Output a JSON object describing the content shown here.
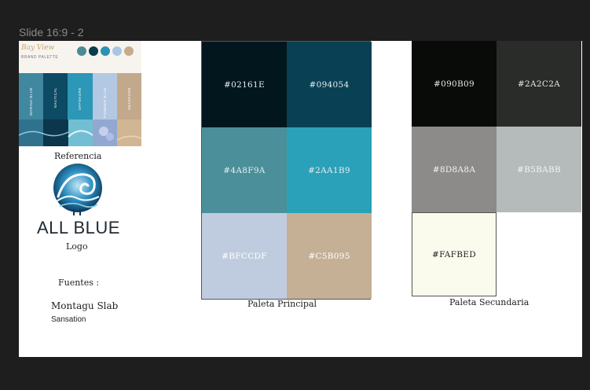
{
  "frame": {
    "label": "Slide 16:9 - 2"
  },
  "reference": {
    "caption": "Referencia",
    "title": "Bay View",
    "subtitle": "BRAND PALETTE",
    "dots": [
      "#4d8a94",
      "#0c3b4c",
      "#2a93b2",
      "#a9c6e4",
      "#c7ab8c"
    ],
    "strips": [
      {
        "label": "MARINA BLUE",
        "color": "#3f88a0"
      },
      {
        "label": "NAUTICAL",
        "color": "#0d4a63"
      },
      {
        "label": "OFFSHORE",
        "color": "#2c97b6"
      },
      {
        "label": "POWDER BLUE",
        "color": "#b3c8e2"
      },
      {
        "label": "SEASHORE",
        "color": "#c3a98b"
      }
    ]
  },
  "logo": {
    "name": "ALL BLUE",
    "label": "Logo"
  },
  "fonts": {
    "heading": "Fuentes :",
    "primary": "Montagu Slab",
    "secondary": "Sansation"
  },
  "paleta_principal": {
    "caption": "Paleta Principal",
    "swatches": [
      {
        "code": "#02161E",
        "color": "#02161E",
        "text_color": "#e8eef0"
      },
      {
        "code": "#094054",
        "color": "#094054",
        "text_color": "#e8eef0"
      },
      {
        "code": "#4A8F9A",
        "color": "#4A8F9A",
        "text_color": "#e8eef0"
      },
      {
        "code": "#2AA1B9",
        "color": "#2AA1B9",
        "text_color": "#e8eef0"
      },
      {
        "code": "#BFCCDF",
        "color": "#BFCCDF",
        "text_color": "#ffffff"
      },
      {
        "code": "#C5B095",
        "color": "#C5B095",
        "text_color": "#ffffff"
      }
    ]
  },
  "paleta_secundaria": {
    "caption": "Paleta Secundaria",
    "swatches": [
      {
        "code": "#090B09",
        "color": "#090B09",
        "text_color": "#e8e8e8"
      },
      {
        "code": "#2A2C2A",
        "color": "#2A2C2A",
        "text_color": "#e8e8e8"
      },
      {
        "code": "#8D8A8A",
        "color": "#8D8A8A",
        "text_color": "#f2f2f2"
      },
      {
        "code": "#B5BABB",
        "color": "#B5BABB",
        "text_color": "#f5f5f5"
      },
      {
        "code": "#FAFBED",
        "color": "#FAFBED",
        "text_color": "#1a1a1a"
      }
    ]
  }
}
